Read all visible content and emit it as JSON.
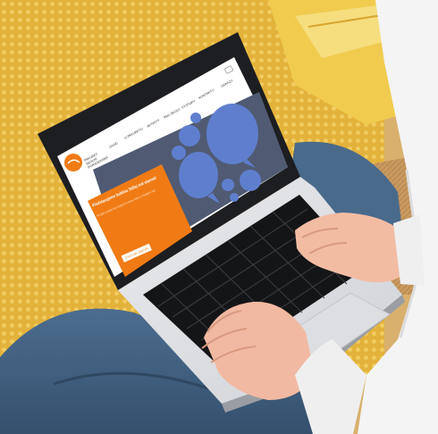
{
  "website": {
    "brand_lines": [
      "PROJEKT",
      "ŠKOLNÍ",
      "PORADENSKÁ"
    ],
    "nav_items": [
      "ÚVOD",
      "O PROJEKTU",
      "AKTIVITY",
      "PRO ŠKOLY",
      "VÝSTUPY",
      "KONTAKTY",
      "ODKAZY"
    ],
    "hero_title": "Představujeme bublinu Sdílej své starosti",
    "hero_text": "Projekt podporuje duševní zdraví dětí a mladých lidí.",
    "hero_button": "Chci se zapojit"
  },
  "colors": {
    "orange": "#f07b15",
    "bubble_blue": "#5f7fce",
    "hero_dark": "#505b73",
    "blanket_yellow": "#e5b53d",
    "jeans": "#41607f"
  }
}
